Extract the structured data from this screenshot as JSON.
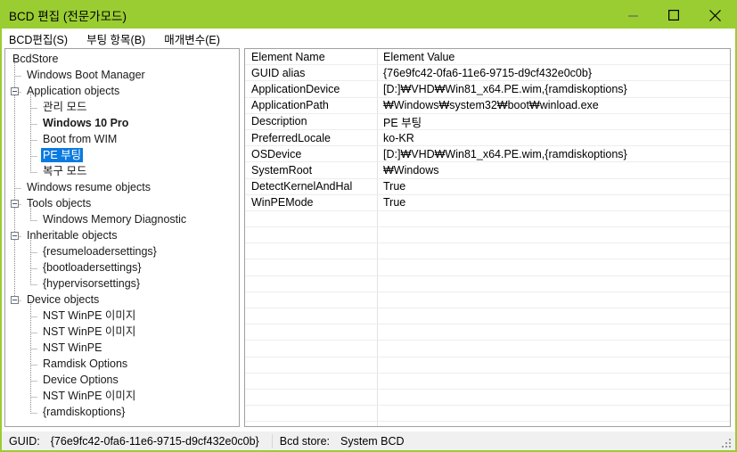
{
  "window": {
    "title": "BCD 편집 (전문가모드)",
    "titlebar_color": "#9acd32",
    "border_color": "#9acd32",
    "controls": {
      "minimize": "minimize",
      "maximize": "maximize",
      "close": "close"
    }
  },
  "menubar": {
    "items": [
      {
        "label": "BCD편집(S)"
      },
      {
        "label": "부팅 항목(B)"
      },
      {
        "label": "매개변수(E)"
      }
    ]
  },
  "tree": {
    "selection_color": "#0a7ae0",
    "nodes": [
      {
        "label": "BcdStore",
        "depth": 0,
        "expander": false,
        "bold": false,
        "selected": false
      },
      {
        "label": "Windows Boot Manager",
        "depth": 1,
        "expander": false,
        "bold": false,
        "selected": false
      },
      {
        "label": "Application objects",
        "depth": 1,
        "expander": true,
        "bold": false,
        "selected": false
      },
      {
        "label": "관리 모드",
        "depth": 2,
        "expander": false,
        "bold": false,
        "selected": false
      },
      {
        "label": "Windows 10 Pro",
        "depth": 2,
        "expander": false,
        "bold": true,
        "selected": false
      },
      {
        "label": "Boot from WIM",
        "depth": 2,
        "expander": false,
        "bold": false,
        "selected": false
      },
      {
        "label": "PE 부팅",
        "depth": 2,
        "expander": false,
        "bold": false,
        "selected": true
      },
      {
        "label": "복구 모드",
        "depth": 2,
        "expander": false,
        "bold": false,
        "selected": false
      },
      {
        "label": "Windows resume objects",
        "depth": 1,
        "expander": false,
        "bold": false,
        "selected": false
      },
      {
        "label": "Tools objects",
        "depth": 1,
        "expander": true,
        "bold": false,
        "selected": false
      },
      {
        "label": "Windows Memory Diagnostic",
        "depth": 2,
        "expander": false,
        "bold": false,
        "selected": false
      },
      {
        "label": "Inheritable objects",
        "depth": 1,
        "expander": true,
        "bold": false,
        "selected": false
      },
      {
        "label": "{resumeloadersettings}",
        "depth": 2,
        "expander": false,
        "bold": false,
        "selected": false
      },
      {
        "label": "{bootloadersettings}",
        "depth": 2,
        "expander": false,
        "bold": false,
        "selected": false
      },
      {
        "label": "{hypervisorsettings}",
        "depth": 2,
        "expander": false,
        "bold": false,
        "selected": false
      },
      {
        "label": "Device objects",
        "depth": 1,
        "expander": true,
        "bold": false,
        "selected": false
      },
      {
        "label": "NST WinPE 이미지",
        "depth": 2,
        "expander": false,
        "bold": false,
        "selected": false
      },
      {
        "label": "NST WinPE 이미지",
        "depth": 2,
        "expander": false,
        "bold": false,
        "selected": false
      },
      {
        "label": "NST WinPE",
        "depth": 2,
        "expander": false,
        "bold": false,
        "selected": false
      },
      {
        "label": "Ramdisk Options",
        "depth": 2,
        "expander": false,
        "bold": false,
        "selected": false
      },
      {
        "label": "Device Options",
        "depth": 2,
        "expander": false,
        "bold": false,
        "selected": false
      },
      {
        "label": "NST WinPE 이미지",
        "depth": 2,
        "expander": false,
        "bold": false,
        "selected": false
      },
      {
        "label": "{ramdiskoptions}",
        "depth": 2,
        "expander": false,
        "bold": false,
        "selected": false
      }
    ]
  },
  "list": {
    "columns": [
      "Element Name",
      "Element Value"
    ],
    "rows": [
      {
        "name": "Element Name",
        "value": "Element Value"
      },
      {
        "name": "GUID alias",
        "value": "{76e9fc42-0fa6-11e6-9715-d9cf432e0c0b}"
      },
      {
        "name": "ApplicationDevice",
        "value": "[D:]₩VHD₩Win81_x64.PE.wim,{ramdiskoptions}"
      },
      {
        "name": "ApplicationPath",
        "value": "₩Windows₩system32₩boot₩winload.exe"
      },
      {
        "name": "Description",
        "value": "PE 부팅"
      },
      {
        "name": "PreferredLocale",
        "value": "ko-KR"
      },
      {
        "name": "OSDevice",
        "value": "[D:]₩VHD₩Win81_x64.PE.wim,{ramdiskoptions}"
      },
      {
        "name": "SystemRoot",
        "value": "₩Windows"
      },
      {
        "name": "DetectKernelAndHal",
        "value": "True"
      },
      {
        "name": "WinPEMode",
        "value": "True"
      }
    ],
    "empty_row_count": 13
  },
  "statusbar": {
    "guid_label": "GUID:",
    "guid_value": "{76e9fc42-0fa6-11e6-9715-d9cf432e0c0b}",
    "store_label": "Bcd store:",
    "store_value": "System BCD"
  }
}
